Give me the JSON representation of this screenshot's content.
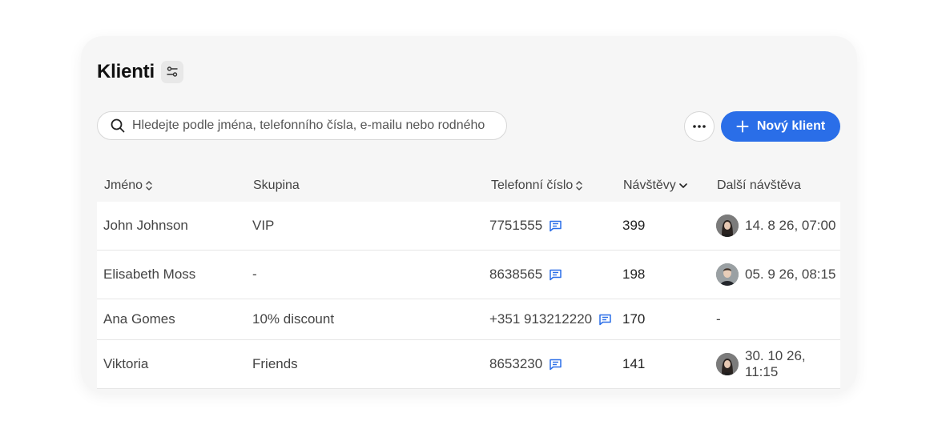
{
  "title": "Klienti",
  "search": {
    "placeholder": "Hledejte podle jména, telefonního čísla, e-mailu nebo rodného"
  },
  "actions": {
    "new_client_label": "Nový klient"
  },
  "columns": {
    "name": "Jméno",
    "group": "Skupina",
    "phone": "Telefonní číslo",
    "visits": "Návštěvy",
    "next_visit": "Další návštěva"
  },
  "rows": [
    {
      "name": "John Johnson",
      "group": "VIP",
      "phone": "7751555",
      "visits": "399",
      "next_visit": "14. 8 26, 07:00"
    },
    {
      "name": "Elisabeth Moss",
      "group": "-",
      "phone": "8638565",
      "visits": "198",
      "next_visit": "05. 9 26, 08:15"
    },
    {
      "name": "Ana Gomes",
      "group": "10% discount",
      "phone": "+351 913212220",
      "visits": "170",
      "next_visit": "-"
    },
    {
      "name": "Viktoria",
      "group": "Friends",
      "phone": "8653230",
      "visits": "141",
      "next_visit": "30. 10 26, 11:15"
    }
  ],
  "colors": {
    "primary": "#2a6ee8",
    "card_background": "#f6f6f6"
  },
  "icons": {
    "settings": "sliders-icon",
    "search": "search-icon",
    "more": "more-horizontal-icon",
    "add": "plus-icon",
    "sort": "sort-icon",
    "message": "message-icon"
  }
}
